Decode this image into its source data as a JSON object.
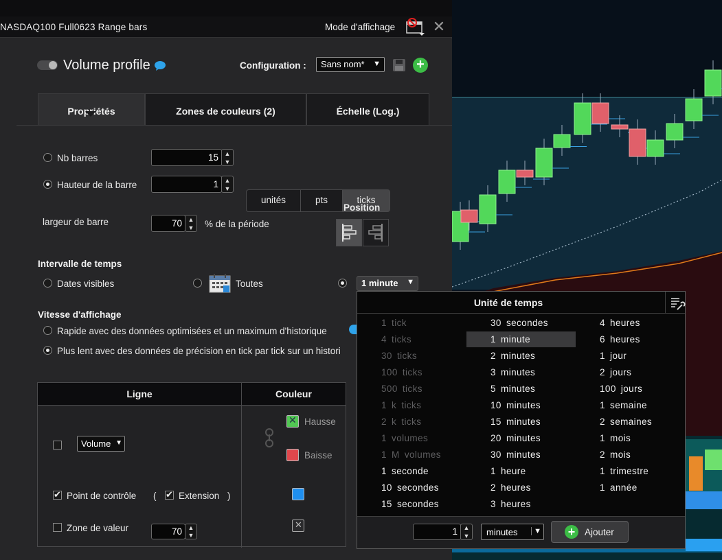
{
  "window": {
    "title": "NASDAQ100 Full0623 Range bars",
    "mode_label": "Mode d'affichage",
    "close_glyph": "✕"
  },
  "header": {
    "indicator_title": "Volume profile",
    "config_label": "Configuration :",
    "config_value": "Sans nom*"
  },
  "tabs": [
    {
      "label": "Propriétés",
      "active": true
    },
    {
      "label": "Zones de couleurs (2)",
      "active": false
    },
    {
      "label": "Échelle (Log.)",
      "active": false
    }
  ],
  "props": {
    "nb_barres_label": "Nb barres",
    "nb_barres_value": "15",
    "hauteur_label": "Hauteur de la barre",
    "hauteur_value": "1",
    "units": [
      "unités",
      "pts",
      "ticks"
    ],
    "units_selected": "ticks",
    "position_label": "Position",
    "largeur_label": "largeur de barre",
    "largeur_value": "70",
    "largeur_unit": "% de la période"
  },
  "interval": {
    "title": "Intervalle de temps",
    "dates_visibles": "Dates visibles",
    "toutes": "Toutes",
    "selected_unit": "1 minute"
  },
  "speed": {
    "title": "Vitesse d'affichage",
    "rapide": "Rapide avec des données optimisées et un maximum d'historique",
    "lent": "Plus lent avec des données de précision en tick par tick sur un histori"
  },
  "table": {
    "col_ligne": "Ligne",
    "col_couleur": "Couleur",
    "volume_select": "Volume",
    "hausse": "Hausse",
    "baisse": "Baisse",
    "point_controle": "Point de contrôle",
    "paren_open": "(",
    "extension": "Extension",
    "paren_close": ")",
    "zone_valeur": "Zone de valeur",
    "zone_valeur_value": "70",
    "colors": {
      "hausse": "#52c754",
      "baisse": "#e0474c",
      "poc": "#1f8fef"
    }
  },
  "popup": {
    "title": "Unité de temps",
    "col1": [
      "1 tick",
      "4 ticks",
      "30 ticks",
      "100 ticks",
      "500 ticks",
      "1 k ticks",
      "2 k ticks",
      "1 volumes",
      "1 M volumes",
      "1 seconde",
      "10 secondes",
      "15 secondes"
    ],
    "col2": [
      "30 secondes",
      "1 minute",
      "2 minutes",
      "3 minutes",
      "5 minutes",
      "10 minutes",
      "15 minutes",
      "20 minutes",
      "30 minutes",
      "1 heure",
      "2 heures",
      "3 heures"
    ],
    "col3": [
      "4 heures",
      "6 heures",
      "1 jour",
      "2 jours",
      "100 jours",
      "1 semaine",
      "2 semaines",
      "1 mois",
      "2 mois",
      "1 trimestre",
      "1 année"
    ],
    "footer_value": "1",
    "footer_unit": "minutes",
    "add_label": "Ajouter"
  }
}
